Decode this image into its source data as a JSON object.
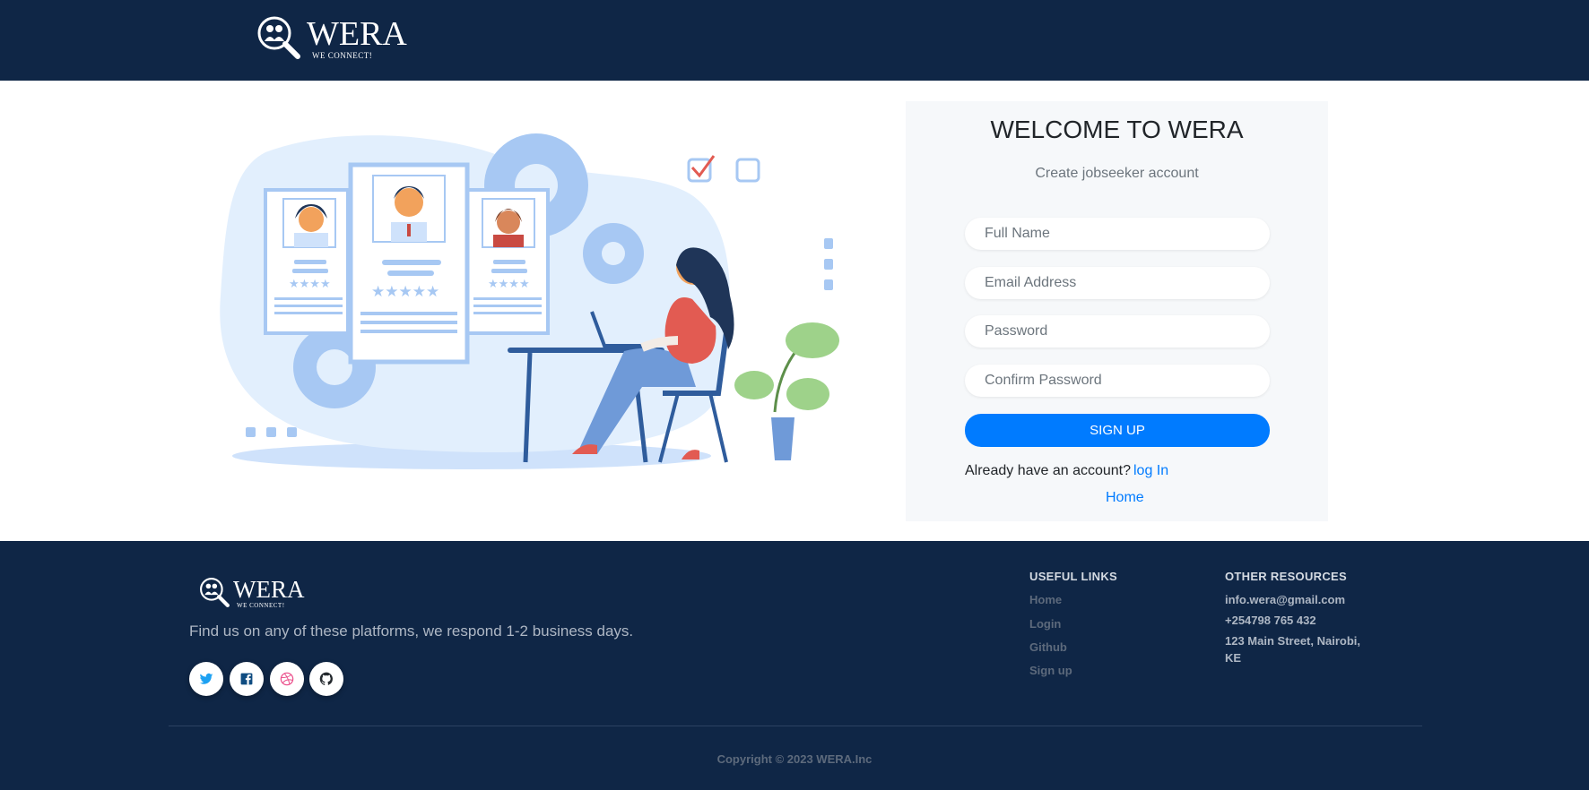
{
  "header": {
    "brand": "WERA",
    "slogan": "WE CONNECT!"
  },
  "signup": {
    "title": "WELCOME TO WERA",
    "subtitle": "Create jobseeker account",
    "fields": {
      "full_name_placeholder": "Full Name",
      "email_placeholder": "Email Address",
      "password_placeholder": "Password",
      "confirm_password_placeholder": "Confirm Password"
    },
    "button_label": "SIGN UP",
    "already_text": "Already have an account?",
    "login_link": "log In",
    "home_link": "Home"
  },
  "footer": {
    "brand": "WERA",
    "slogan": "WE CONNECT!",
    "tagline": "Find us on any of these platforms, we respond 1-2 business days.",
    "social_icons": [
      "twitter-icon",
      "facebook-icon",
      "dribbble-icon",
      "github-icon"
    ],
    "useful_links": {
      "heading": "USEFUL LINKS",
      "items": [
        "Home",
        "Login",
        "Github",
        "Sign up"
      ]
    },
    "other_resources": {
      "heading": "OTHER RESOURCES",
      "email": "info.wera@gmail.com",
      "phone": "+254798 765 432",
      "address": "123 Main Street, Nairobi, KE"
    },
    "copyright": "Copyright © 2023 WERA.Inc"
  },
  "colors": {
    "navy": "#0f2646",
    "primary": "#007bff",
    "panel": "#f6f8fa"
  }
}
